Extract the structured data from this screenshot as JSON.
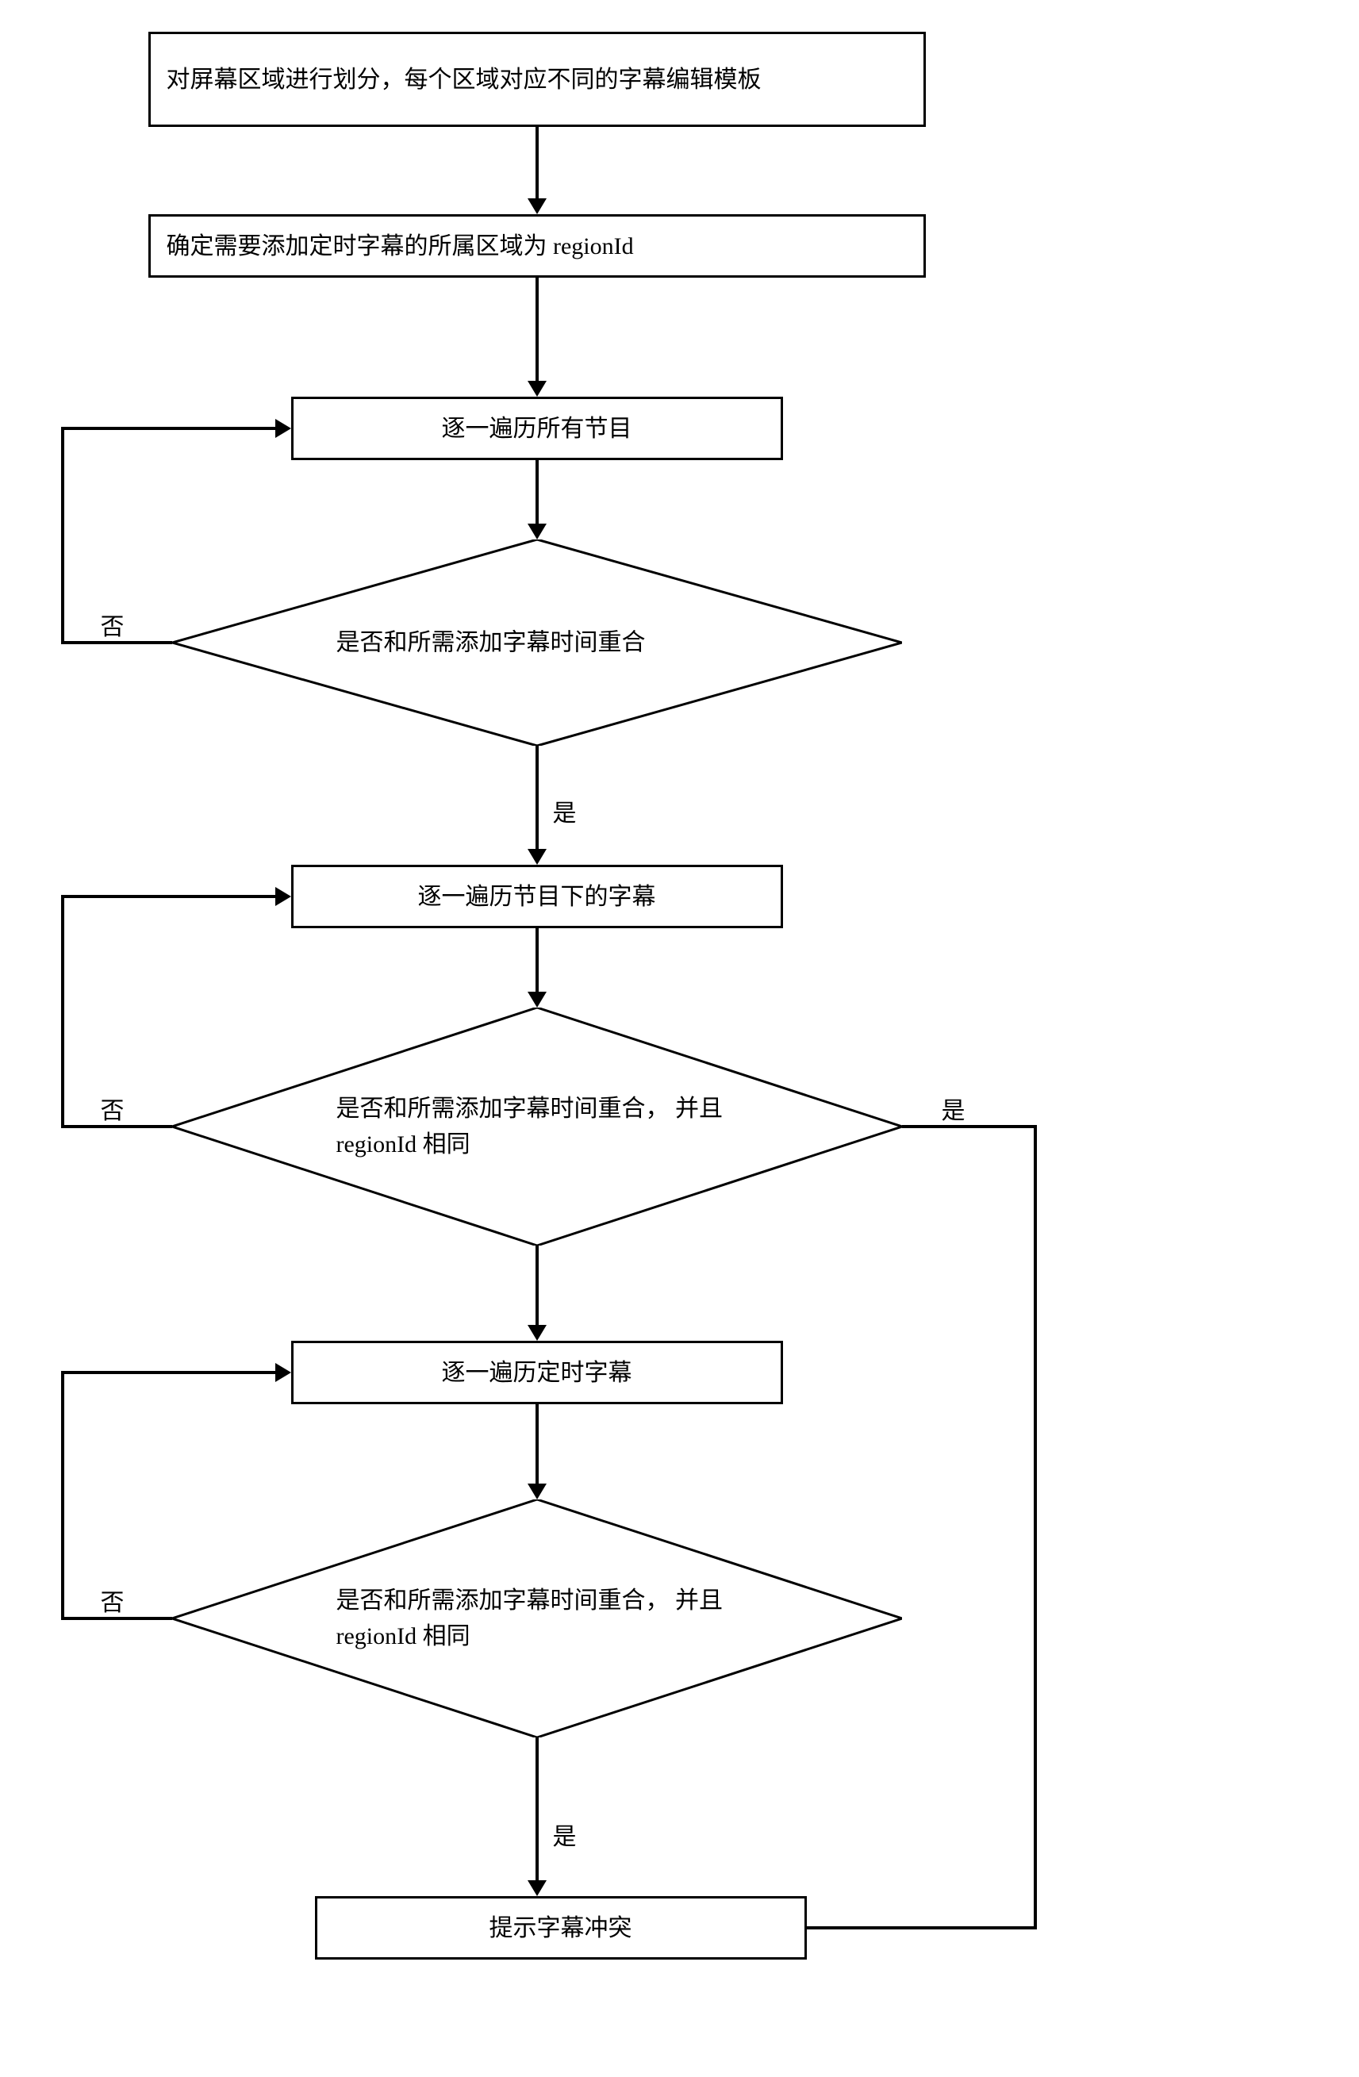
{
  "nodes": {
    "step1": "对屏幕区域进行划分，每个区域对应不同的字幕编辑模板",
    "step2": "确定需要添加定时字幕的所属区域为 regionId",
    "step3": "逐一遍历所有节目",
    "decision1": "是否和所需添加字幕时间重合",
    "step4": "逐一遍历节目下的字幕",
    "decision2": "是否和所需添加字幕时间重合， 并且regionId 相同",
    "step5": "逐一遍历定时字幕",
    "decision3": "是否和所需添加字幕时间重合， 并且regionId 相同",
    "step6": "提示字幕冲突"
  },
  "labels": {
    "no": "否",
    "yes": "是"
  }
}
